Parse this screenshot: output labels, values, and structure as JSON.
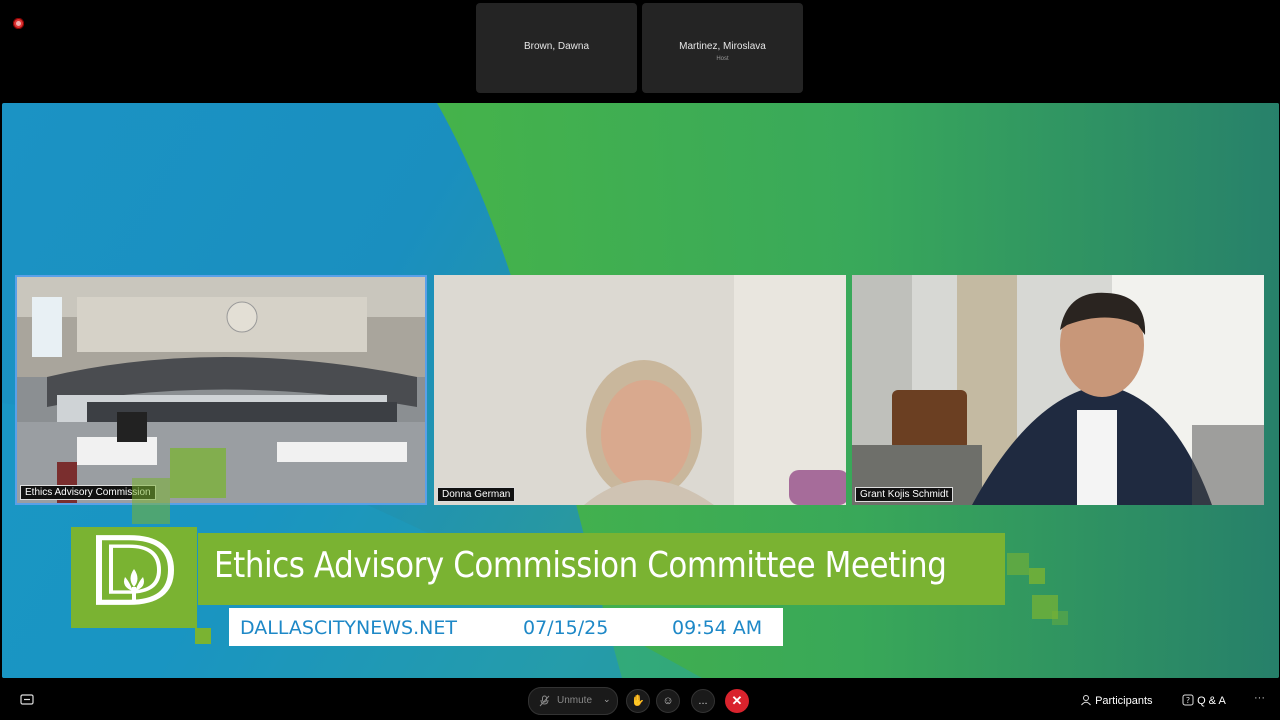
{
  "top_tiles": [
    {
      "name": "Brown, Dawna",
      "sub": ""
    },
    {
      "name": "Martinez, Miroslava",
      "sub": "Host"
    }
  ],
  "videos": [
    {
      "label": "Ethics Advisory Commission"
    },
    {
      "label": "Donna German"
    },
    {
      "label": "Grant Kojis Schmidt"
    }
  ],
  "banner": {
    "title": "Ethics Advisory Commission Committee Meeting",
    "site": "DALLASCITYNEWS.NET",
    "date": "07/15/25",
    "time": "09:54 AM"
  },
  "toolbar": {
    "unmute_label": "Unmute",
    "participants_label": "Participants",
    "qa_label": "Q & A",
    "more_label": "..."
  },
  "colors": {
    "accent_green": "#7ab332",
    "info_blue": "#1e88c7",
    "leave_red": "#d9232d"
  }
}
